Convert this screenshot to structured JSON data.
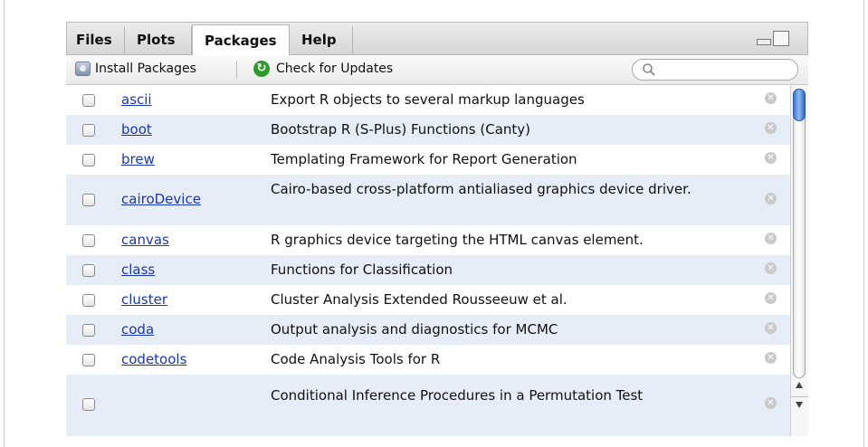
{
  "tabs": [
    {
      "label": "Files",
      "active": false
    },
    {
      "label": "Plots",
      "active": false
    },
    {
      "label": "Packages",
      "active": true
    },
    {
      "label": "Help",
      "active": false
    }
  ],
  "toolbar": {
    "install_label": "Install Packages",
    "update_label": "Check for Updates",
    "search_placeholder": ""
  },
  "packages": [
    {
      "name": "ascii",
      "description": "Export R objects to several markup languages"
    },
    {
      "name": "boot",
      "description": "Bootstrap R (S-Plus) Functions (Canty)"
    },
    {
      "name": "brew",
      "description": "Templating Framework for Report Generation"
    },
    {
      "name": "cairoDevice",
      "description": "Cairo-based cross-platform antialiased graphics device driver."
    },
    {
      "name": "canvas",
      "description": "R graphics device targeting the HTML canvas element."
    },
    {
      "name": "class",
      "description": "Functions for Classification"
    },
    {
      "name": "cluster",
      "description": "Cluster Analysis Extended Rousseeuw et al."
    },
    {
      "name": "coda",
      "description": "Output analysis and diagnostics for MCMC"
    },
    {
      "name": "codetools",
      "description": "Code Analysis Tools for R"
    },
    {
      "name": "",
      "description": "Conditional Inference Procedures in a Permutation Test"
    }
  ],
  "colors": {
    "link": "#1a36b8",
    "row_alt": "#e6edf6",
    "update_icon": "#2f9a2a"
  },
  "icons": {
    "install": "install-packages-icon",
    "update": "refresh-icon",
    "search": "search-icon",
    "remove": "remove-icon"
  }
}
